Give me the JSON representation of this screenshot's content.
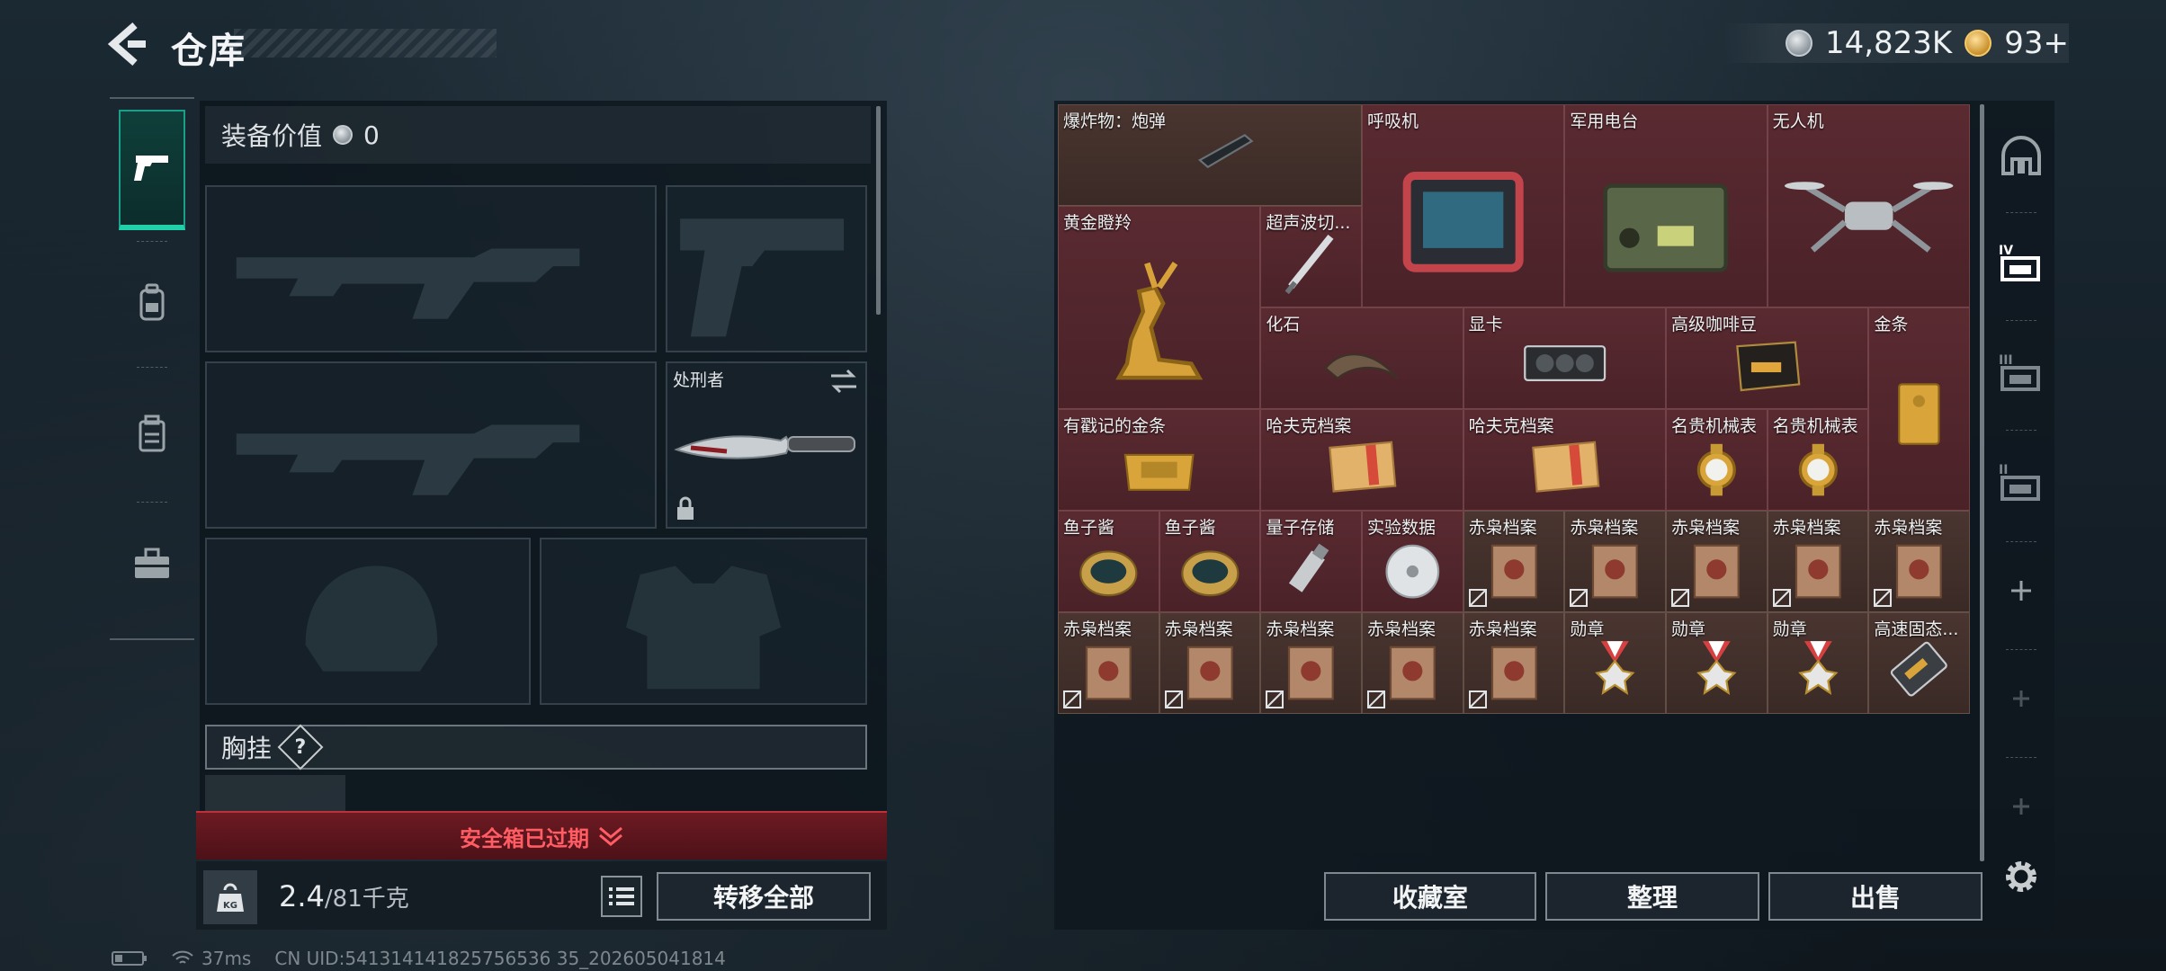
{
  "header": {
    "title": "仓库",
    "currency_amount": "14,823K",
    "premium_amount": "93+"
  },
  "loadout": {
    "equip_value_label": "装备价值",
    "equip_value": "0",
    "melee_name": "处刑者",
    "chest_rig_label": "胸挂",
    "chest_rig_help": "?",
    "safebox_expired": "安全箱已过期",
    "weight_current": "2.4",
    "weight_max": "/81千克",
    "kg_label": "KG",
    "transfer_all": "转移全部"
  },
  "stash": {
    "items": [
      {
        "label": "爆炸物：炮弹",
        "color": "brown",
        "icon": "shell-icon"
      },
      {
        "label": "呼吸机",
        "color": "red",
        "icon": "ventilator-icon"
      },
      {
        "label": "军用电台",
        "color": "red",
        "icon": "radio-icon"
      },
      {
        "label": "无人机",
        "color": "red",
        "icon": "drone-icon"
      },
      {
        "label": "黄金瞪羚",
        "color": "red",
        "icon": "gold-gazelle-icon"
      },
      {
        "label": "超声波切...",
        "color": "red",
        "icon": "ultrasonic-cutter-icon"
      },
      {
        "label": "化石",
        "color": "red",
        "icon": "fossil-claw-icon"
      },
      {
        "label": "显卡",
        "color": "red",
        "icon": "gpu-icon"
      },
      {
        "label": "高级咖啡豆",
        "color": "red",
        "icon": "coffee-bag-icon"
      },
      {
        "label": "金条",
        "color": "red",
        "icon": "gold-bar-icon"
      },
      {
        "label": "有戳记的金条",
        "color": "red",
        "icon": "stamped-gold-bar-icon"
      },
      {
        "label": "哈夫克档案",
        "color": "red",
        "icon": "file-folder-icon"
      },
      {
        "label": "哈夫克档案",
        "color": "red",
        "icon": "file-folder-icon"
      },
      {
        "label": "名贵机械表",
        "color": "red",
        "icon": "gold-watch-icon"
      },
      {
        "label": "名贵机械表",
        "color": "red",
        "icon": "gold-watch-icon"
      },
      {
        "label": "鱼子酱",
        "color": "red",
        "icon": "caviar-icon"
      },
      {
        "label": "鱼子酱",
        "color": "red",
        "icon": "caviar-icon"
      },
      {
        "label": "量子存储",
        "color": "red",
        "icon": "usb-drive-icon"
      },
      {
        "label": "实验数据",
        "color": "red",
        "icon": "disc-icon"
      },
      {
        "label": "赤枭档案",
        "color": "brown",
        "icon": "dossier-icon"
      },
      {
        "label": "赤枭档案",
        "color": "brown",
        "icon": "dossier-icon"
      },
      {
        "label": "赤枭档案",
        "color": "brown",
        "icon": "dossier-icon"
      },
      {
        "label": "赤枭档案",
        "color": "brown",
        "icon": "dossier-icon"
      },
      {
        "label": "赤枭档案",
        "color": "brown",
        "icon": "dossier-icon"
      },
      {
        "label": "赤枭档案",
        "color": "brown",
        "icon": "dossier-icon"
      },
      {
        "label": "赤枭档案",
        "color": "brown",
        "icon": "dossier-icon"
      },
      {
        "label": "赤枭档案",
        "color": "brown",
        "icon": "dossier-icon"
      },
      {
        "label": "赤枭档案",
        "color": "brown",
        "icon": "dossier-icon"
      },
      {
        "label": "赤枭档案",
        "color": "brown",
        "icon": "dossier-icon"
      },
      {
        "label": "勋章",
        "color": "brown",
        "icon": "medal-icon"
      },
      {
        "label": "勋章",
        "color": "brown",
        "icon": "medal-icon"
      },
      {
        "label": "勋章",
        "color": "brown",
        "icon": "medal-icon"
      },
      {
        "label": "高速固态...",
        "color": "brown",
        "icon": "ssd-icon"
      }
    ],
    "buttons": {
      "collection": "收藏室",
      "sort": "整理",
      "sell": "出售"
    }
  },
  "status_bar": {
    "ping": "37ms",
    "uid": "CN UID:541314141825756536 35_202605041814"
  },
  "colors": {
    "accent_teal": "#20d0a8",
    "expired_red": "#ff5c63",
    "rare_red_cell": "#5a2a31",
    "brown_cell": "#4a3530"
  }
}
